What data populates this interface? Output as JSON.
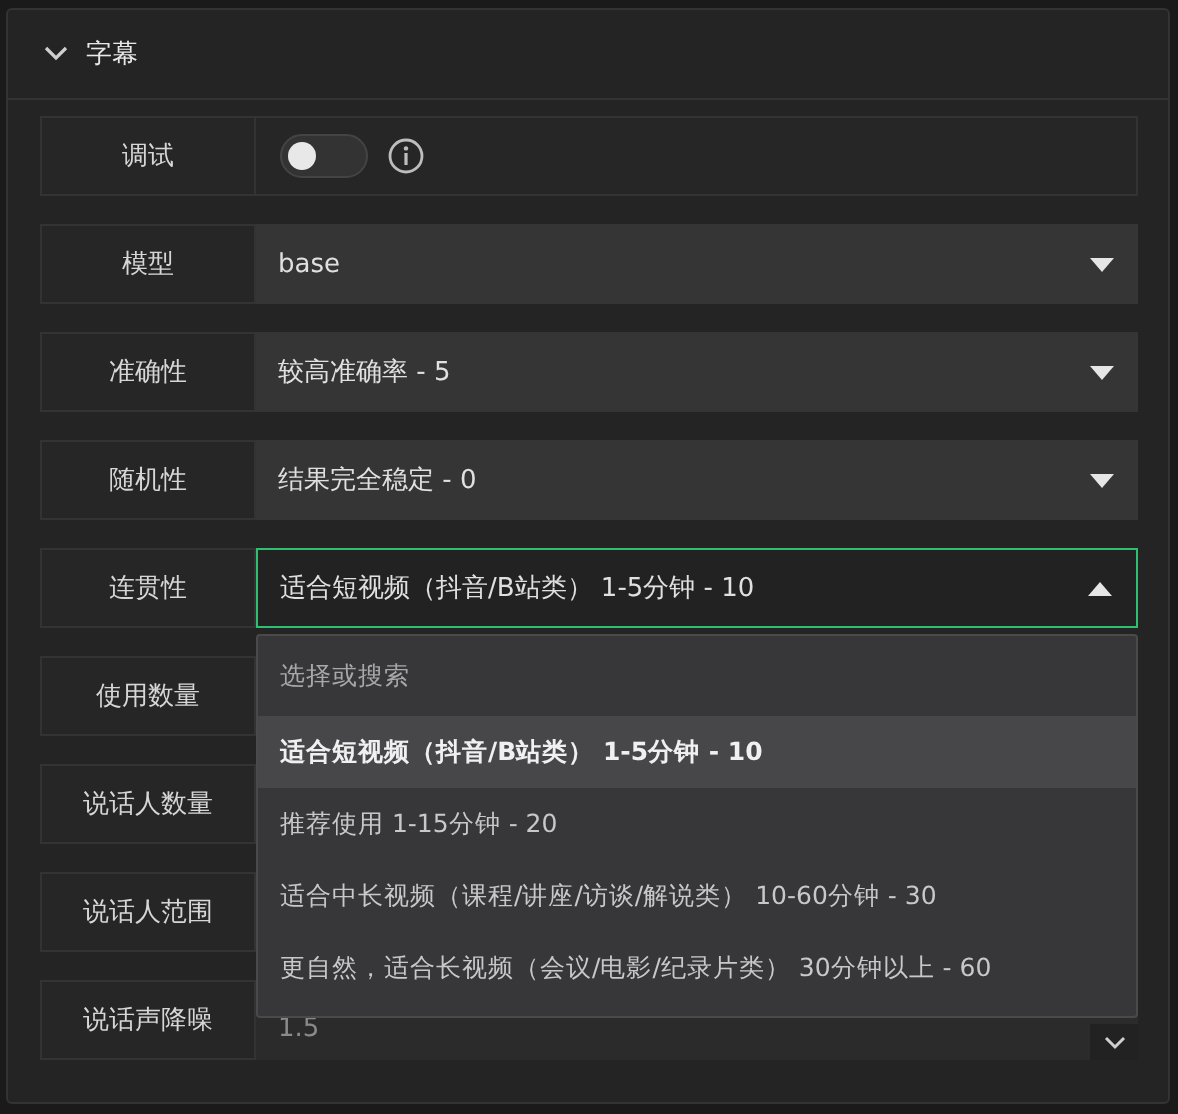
{
  "section": {
    "title": "字幕",
    "expanded": true
  },
  "rows": [
    {
      "kind": "switch",
      "label": "调试",
      "on": false
    },
    {
      "kind": "select",
      "label": "模型",
      "value": "base",
      "open": false
    },
    {
      "kind": "select",
      "label": "准确性",
      "value": "较高准确率 - 5",
      "open": false
    },
    {
      "kind": "select",
      "label": "随机性",
      "value": "结果完全稳定 - 0",
      "open": false
    },
    {
      "kind": "select",
      "label": "连贯性",
      "value": "适合短视频（抖音/B站类） 1-5分钟 - 10",
      "open": true,
      "menu": {
        "placeholder": "选择或搜索",
        "options": [
          {
            "label": "适合短视频（抖音/B站类） 1-5分钟 - 10",
            "selected": true
          },
          {
            "label": "推荐使用 1-15分钟 - 20",
            "selected": false
          },
          {
            "label": "适合中长视频（课程/讲座/访谈/解说类） 10-60分钟 - 30",
            "selected": false
          },
          {
            "label": "更自然，适合长视频（会议/电影/纪录片类） 30分钟以上 - 60",
            "selected": false
          }
        ]
      }
    },
    {
      "kind": "covered",
      "label": "使用数量"
    },
    {
      "kind": "covered",
      "label": "说话人数量"
    },
    {
      "kind": "covered",
      "label": "说话人范围"
    },
    {
      "kind": "number",
      "label": "说话声降噪",
      "value": "1.5"
    }
  ]
}
